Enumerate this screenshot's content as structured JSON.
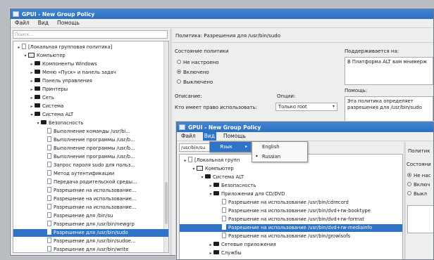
{
  "back_window": {
    "title": "GPUI - New Group Policy",
    "menu": [
      "Файл",
      "Вид",
      "Помощь"
    ],
    "filter_placeholder": "Поиск...",
    "tree": [
      {
        "depth": 0,
        "twist": "▸",
        "icon": "doc",
        "label": "[Локальная групповая политика]"
      },
      {
        "depth": 1,
        "twist": "▾",
        "icon": "comp",
        "label": "Компьютер"
      },
      {
        "depth": 2,
        "twist": "▸",
        "icon": "folder",
        "label": "Компоненты Windows"
      },
      {
        "depth": 2,
        "twist": "▸",
        "icon": "folder",
        "label": "Меню «Пуск» и панель задач"
      },
      {
        "depth": 2,
        "twist": "▸",
        "icon": "folder",
        "label": "Панель управления"
      },
      {
        "depth": 2,
        "twist": "▸",
        "icon": "folder",
        "label": "Принтеры"
      },
      {
        "depth": 2,
        "twist": "▸",
        "icon": "folder",
        "label": "Сеть"
      },
      {
        "depth": 2,
        "twist": "▸",
        "icon": "folder",
        "label": "Система"
      },
      {
        "depth": 2,
        "twist": "▾",
        "icon": "folder",
        "label": "Система ALT"
      },
      {
        "depth": 3,
        "twist": "▾",
        "icon": "folder",
        "label": "Безопасность"
      },
      {
        "depth": 4,
        "twist": "",
        "icon": "doc",
        "label": "Выполнение команды /usr/bi..."
      },
      {
        "depth": 4,
        "twist": "",
        "icon": "doc",
        "label": "Выполнение программы /usr/b..."
      },
      {
        "depth": 4,
        "twist": "",
        "icon": "doc",
        "label": "Выполнение программы /usr/b..."
      },
      {
        "depth": 4,
        "twist": "",
        "icon": "doc",
        "label": "Выполнение программы /usr/b..."
      },
      {
        "depth": 4,
        "twist": "",
        "icon": "doc",
        "label": "Запрос пароля sudo для польз..."
      },
      {
        "depth": 4,
        "twist": "",
        "icon": "doc",
        "label": "Метод аутентификации"
      },
      {
        "depth": 4,
        "twist": "",
        "icon": "doc",
        "label": "Передача родительской среды..."
      },
      {
        "depth": 4,
        "twist": "",
        "icon": "doc",
        "label": "Разрешение на использование..."
      },
      {
        "depth": 4,
        "twist": "",
        "icon": "doc",
        "label": "Разрешение на использование..."
      },
      {
        "depth": 4,
        "twist": "",
        "icon": "doc",
        "label": "Разрешение на использование..."
      },
      {
        "depth": 4,
        "twist": "",
        "icon": "doc",
        "label": "Разрешение для /bin/su"
      },
      {
        "depth": 4,
        "twist": "",
        "icon": "doc",
        "label": "Разрешение для /usr/bin/newgrp"
      },
      {
        "depth": 4,
        "twist": "",
        "icon": "doc",
        "label": "Разрешение для /usr/bin/sudo",
        "selected": true
      },
      {
        "depth": 4,
        "twist": "",
        "icon": "doc",
        "label": "Разрешение для /usr/bin/sudoe..."
      },
      {
        "depth": 4,
        "twist": "",
        "icon": "doc",
        "label": "Разрешение для /usr/bin/write"
      }
    ],
    "policy_title": "Политика: Разрешения для /usr/bin/sudo",
    "state_label": "Состояние политики",
    "states": [
      {
        "label": "Не настроено",
        "checked": false
      },
      {
        "label": "Включено",
        "checked": true
      },
      {
        "label": "Выключено",
        "checked": false
      }
    ],
    "supported_label": "Поддерживается на:",
    "supported_text": "В Платформа ALT вам мнимерж",
    "description_label": "Описание:",
    "options_label": "Опции:",
    "help_label": "Помощь:",
    "option_row_label": "Кто имеет право использовать:",
    "option_value": "Только root",
    "help_text": "Эта политика определяет разрешения для /usr/bin/sudo"
  },
  "front_window": {
    "title": "GPUI - New Group Policy",
    "menu": [
      "Файл",
      "Вид",
      "Помощь"
    ],
    "filter_value": "/usr/bin/su",
    "view_menu": [
      {
        "label": "Язык",
        "submenu": true
      }
    ],
    "language_menu": [
      {
        "label": "English",
        "checked": false
      },
      {
        "label": "Russian",
        "checked": true
      }
    ],
    "tree": [
      {
        "depth": 0,
        "twist": "▸",
        "icon": "doc",
        "label": "[Локальная групп"
      },
      {
        "depth": 1,
        "twist": "▾",
        "icon": "comp",
        "label": "Компьютер"
      },
      {
        "depth": 2,
        "twist": "▾",
        "icon": "folder",
        "label": "Система ALT"
      },
      {
        "depth": 3,
        "twist": "▸",
        "icon": "folder",
        "label": "Безопасность"
      },
      {
        "depth": 3,
        "twist": "▾",
        "icon": "folder",
        "label": "Приложения для CD/DVD"
      },
      {
        "depth": 4,
        "twist": "",
        "icon": "doc",
        "label": "Разрешение на использование /usr/bin/cdrecord"
      },
      {
        "depth": 4,
        "twist": "",
        "icon": "doc",
        "label": "Разрешение на использование /usr/bin/dvd+rw-booktype"
      },
      {
        "depth": 4,
        "twist": "",
        "icon": "doc",
        "label": "Разрешение на использование /usr/bin/dvd+rw-format"
      },
      {
        "depth": 4,
        "twist": "",
        "icon": "doc",
        "label": "Разрешение на использование /usr/bin/dvd+rw-mediainfo",
        "selected": true
      },
      {
        "depth": 4,
        "twist": "",
        "icon": "doc",
        "label": "Разрешение на использование /usr/bin/growisofs"
      },
      {
        "depth": 3,
        "twist": "▸",
        "icon": "folder",
        "label": "Сетевые приложения"
      },
      {
        "depth": 3,
        "twist": "▸",
        "icon": "folder",
        "label": "Службы"
      }
    ],
    "right_labels": [
      "Политик",
      "Состояни"
    ],
    "states": [
      {
        "label": "Не нас",
        "checked": true
      },
      {
        "label": "Включ",
        "checked": false
      },
      {
        "label": "Выкл",
        "checked": false
      }
    ]
  },
  "colors": {
    "titlebar": "#2f73c6",
    "selection": "#2f73c6",
    "desktop": "#b9bdc1"
  }
}
